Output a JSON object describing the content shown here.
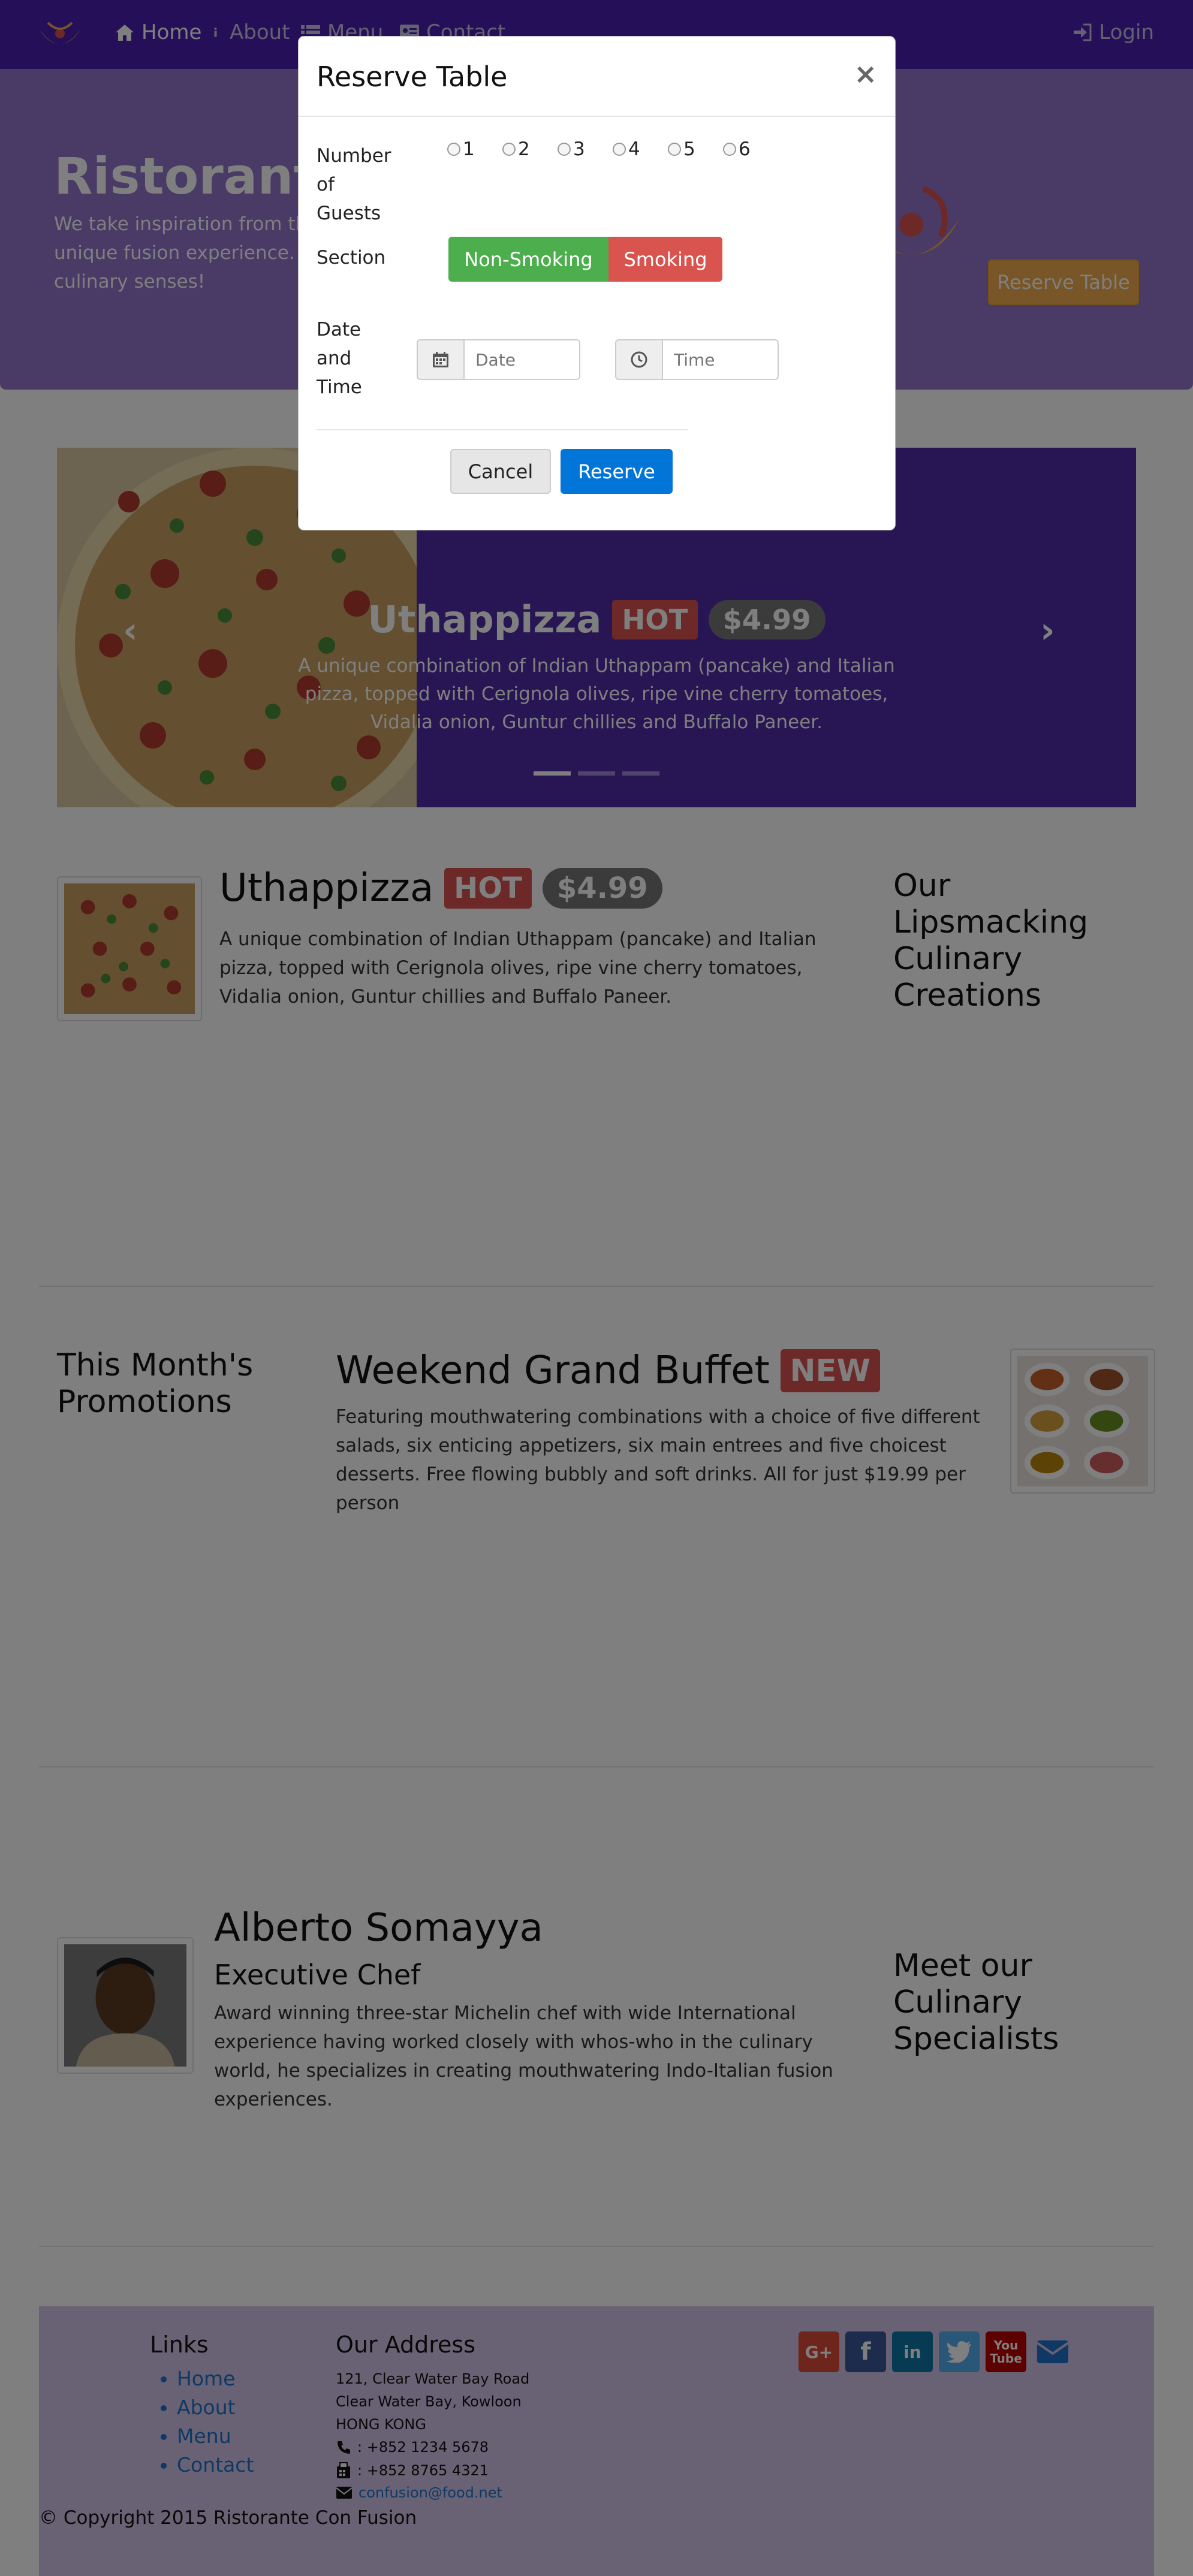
{
  "navbar": {
    "home": "Home",
    "about": "About",
    "menu": "Menu",
    "contact": "Contact",
    "login": "Login"
  },
  "jumbotron": {
    "title": "Ristorante con Fusion",
    "text": "We take inspiration from the World's best cuisines, and create a unique fusion experience. Our lipsmacking creations will tickle your culinary senses!",
    "reserve_button": "Reserve Table"
  },
  "carousel": {
    "title": "Uthappizza",
    "badge": "HOT",
    "price": "$4.99",
    "description": "A unique combination of Indian Uthappam (pancake) and Italian pizza, topped with Cerignola olives, ripe vine cherry tomatoes, Vidalia onion, Guntur chillies and Buffalo Paneer.",
    "prev": "‹",
    "next": "›"
  },
  "dish": {
    "title": "Uthappizza",
    "badge": "HOT",
    "price": "$4.99",
    "description": "A unique combination of Indian Uthappam (pancake) and Italian pizza, topped with Cerignola olives, ripe vine cherry tomatoes, Vidalia onion, Guntur chillies and Buffalo Paneer.",
    "side_heading": "Our Lipsmacking Culinary Creations"
  },
  "promotion": {
    "side_heading": "This Month's Promotions",
    "title": "Weekend Grand Buffet",
    "badge": "NEW",
    "description": "Featuring mouthwatering combinations with a choice of five different salads, six enticing appetizers, six main entrees and five choicest desserts. Free flowing bubbly and soft drinks. All for just $19.99 per person"
  },
  "leader": {
    "name": "Alberto Somayya",
    "role": "Executive Chef",
    "description": "Award winning three-star Michelin chef with wide International experience having worked closely with whos-who in the culinary world, he specializes in creating mouthwatering Indo-Italian fusion experiences.",
    "side_heading": "Meet our Culinary Specialists"
  },
  "footer": {
    "links_heading": "Links",
    "links": [
      "Home",
      "About",
      "Menu",
      "Contact"
    ],
    "address_heading": "Our Address",
    "address": [
      "121, Clear Water Bay Road",
      "Clear Water Bay, Kowloon",
      "HONG KONG"
    ],
    "phone": ": +852 1234 5678",
    "fax": ": +852 8765 4321",
    "email": "confusion@food.net",
    "copyright": "© Copyright 2015 Ristorante Con Fusion"
  },
  "modal": {
    "title": "Reserve Table",
    "close": "×",
    "guests_label": "Number of Guests",
    "guest_options": [
      "1",
      "2",
      "3",
      "4",
      "5",
      "6"
    ],
    "section_label": "Section",
    "non_smoking": "Non-Smoking",
    "smoking": "Smoking",
    "datetime_label": "Date and Time",
    "date_placeholder": "Date",
    "time_placeholder": "Time",
    "cancel": "Cancel",
    "reserve": "Reserve"
  },
  "colors": {
    "navbar": "#4b1fb0",
    "jumbotron": "#9575cd",
    "carousel": "#512da8",
    "footer": "#d1c4e9",
    "reserve_button": "#f0ad4e",
    "non_smoking": "#4cae4c",
    "smoking": "#d9534f",
    "primary": "#0275d8"
  }
}
